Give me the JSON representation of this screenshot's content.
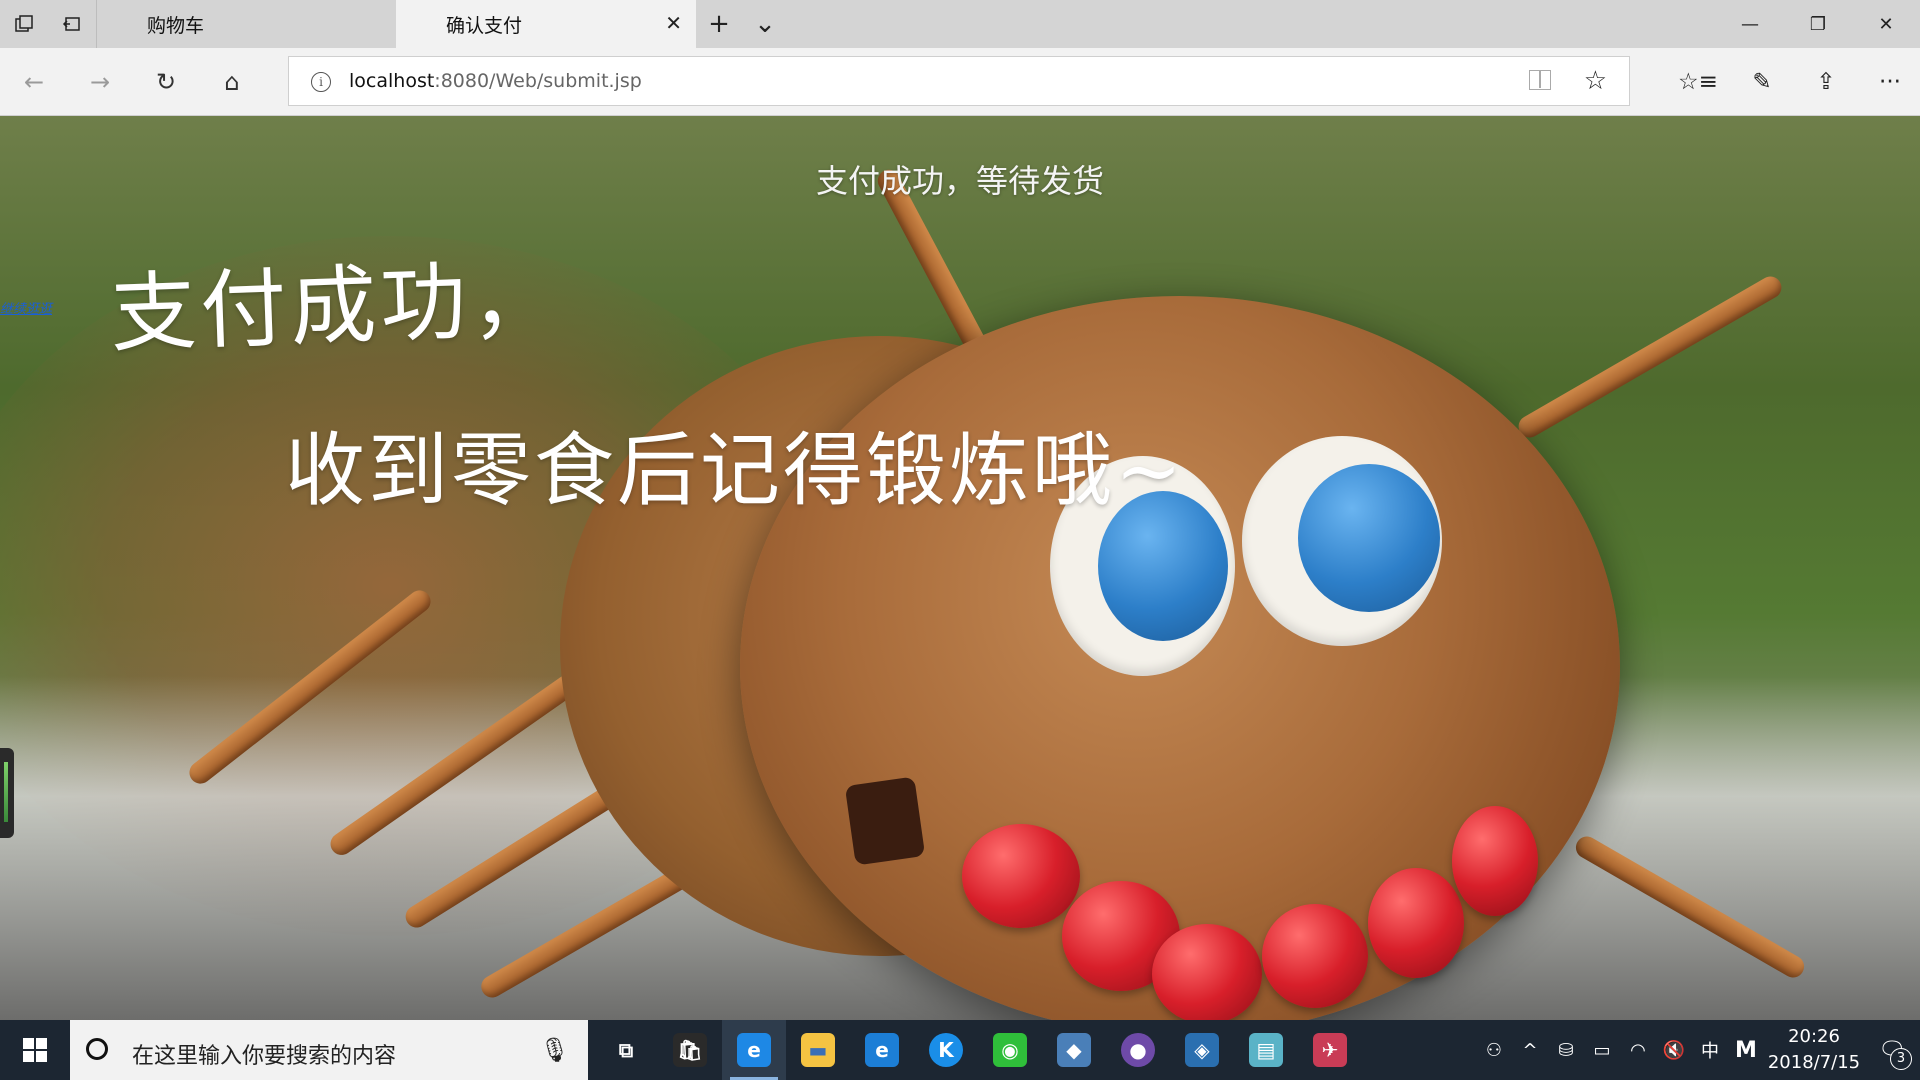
{
  "browser": {
    "tabs": [
      {
        "label": "购物车",
        "active": false
      },
      {
        "label": "确认支付",
        "active": true
      }
    ],
    "tab_close_glyph": "✕",
    "new_tab_glyph": "+",
    "tab_list_glyph": "⌄",
    "window_controls": {
      "minimize": "—",
      "maximize": "❐",
      "close": "✕"
    },
    "nav": {
      "back": "←",
      "forward": "→",
      "refresh": "↻",
      "home": "⌂"
    },
    "address": {
      "host": "localhost",
      "path": ":8080/Web/submit.jsp",
      "info_glyph": "i"
    },
    "favorite_glyph": "☆",
    "tools": {
      "favorites": "☆≡",
      "notes": "✎",
      "share": "⇪",
      "more": "···"
    }
  },
  "page": {
    "title": "支付成功，等待发货",
    "side_link": "继续逛逛",
    "message_line1": "支付成功，",
    "message_line2": "收到零食后记得锻炼哦~"
  },
  "taskbar": {
    "search_placeholder": "在这里输入你要搜索的内容",
    "mic_glyph": "🎙",
    "apps": [
      {
        "name": "task-view",
        "glyph": "⧉",
        "color": "#1c2632"
      },
      {
        "name": "store",
        "glyph": "🛍",
        "color": "#1c2632"
      },
      {
        "name": "edge",
        "glyph": "e",
        "color": "#1e88e5"
      },
      {
        "name": "file-explorer",
        "glyph": "▬",
        "color": "#f5c342"
      },
      {
        "name": "internet-explorer",
        "glyph": "e",
        "color": "#1c7ed6"
      },
      {
        "name": "kugou",
        "glyph": "K",
        "color": "#1a8ee8"
      },
      {
        "name": "wechat",
        "glyph": "◉",
        "color": "#2fbf3a"
      },
      {
        "name": "virtualbox",
        "glyph": "◆",
        "color": "#4a7fb8"
      },
      {
        "name": "github",
        "glyph": "●",
        "color": "#6e4aa8"
      },
      {
        "name": "mysql-workbench",
        "glyph": "◈",
        "color": "#2a6fb0"
      },
      {
        "name": "notepad",
        "glyph": "▤",
        "color": "#5ab3c7"
      },
      {
        "name": "flying-app",
        "glyph": "✈",
        "color": "#c93c56"
      }
    ],
    "tray": {
      "people": "⚇",
      "chevron": "^",
      "usb": "⛁",
      "battery": "▭",
      "wifi": "◠",
      "volume": "🔇",
      "ime": "中",
      "ime_mode": "M"
    },
    "time": "20:26",
    "date": "2018/7/15",
    "notifications": "3"
  }
}
